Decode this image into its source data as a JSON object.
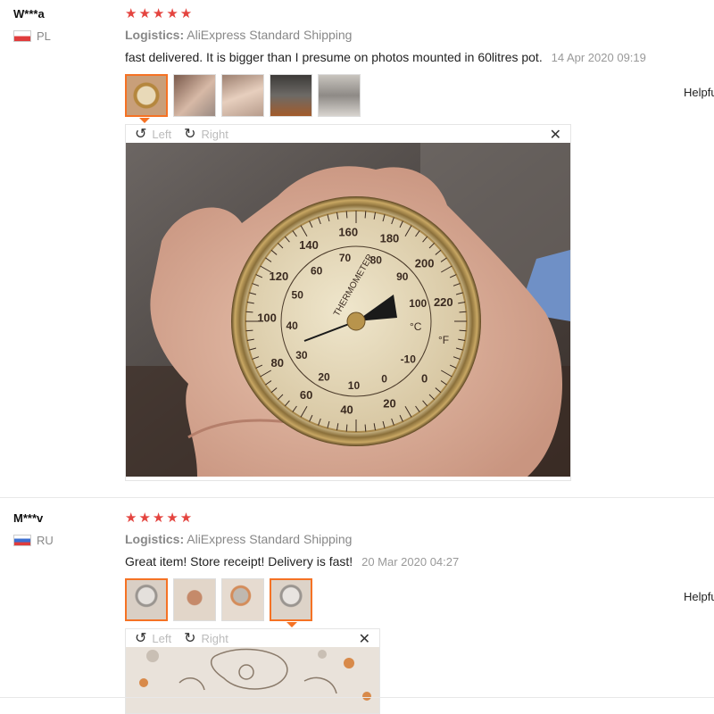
{
  "reviews": [
    {
      "user": "W***a",
      "country": "PL",
      "stars": "★★★★★",
      "logistics_label": "Logistics:",
      "logistics_value": "AliExpress Standard Shipping",
      "comment": "fast delivered. It is bigger than I presume on photos mounted in 60litres pot.",
      "date": "14 Apr 2020 09:19",
      "helpful": "Helpful",
      "viewer": {
        "left": "Left",
        "right": "Right",
        "close": "✕"
      }
    },
    {
      "user": "M***v",
      "country": "RU",
      "stars": "★★★★★",
      "logistics_label": "Logistics:",
      "logistics_value": "AliExpress Standard Shipping",
      "comment": "Great item! Store receipt! Delivery is fast!",
      "date": "20 Mar 2020 04:27",
      "helpful": "Helpful",
      "viewer": {
        "left": "Left",
        "right": "Right",
        "close": "✕"
      }
    }
  ],
  "thermometer": {
    "outer_scale": [
      "160",
      "180",
      "200",
      "220",
      "140",
      "120",
      "100",
      "80",
      "60",
      "40",
      "20",
      "0"
    ],
    "inner_scale": [
      "70",
      "80",
      "90",
      "100",
      "60",
      "50",
      "40",
      "30",
      "20",
      "10",
      "0",
      "-10"
    ],
    "label": "THERMOMETER",
    "units_c": "°C",
    "units_f": "°F"
  },
  "colors": {
    "star": "#e4443f",
    "active_border": "#f57224"
  }
}
